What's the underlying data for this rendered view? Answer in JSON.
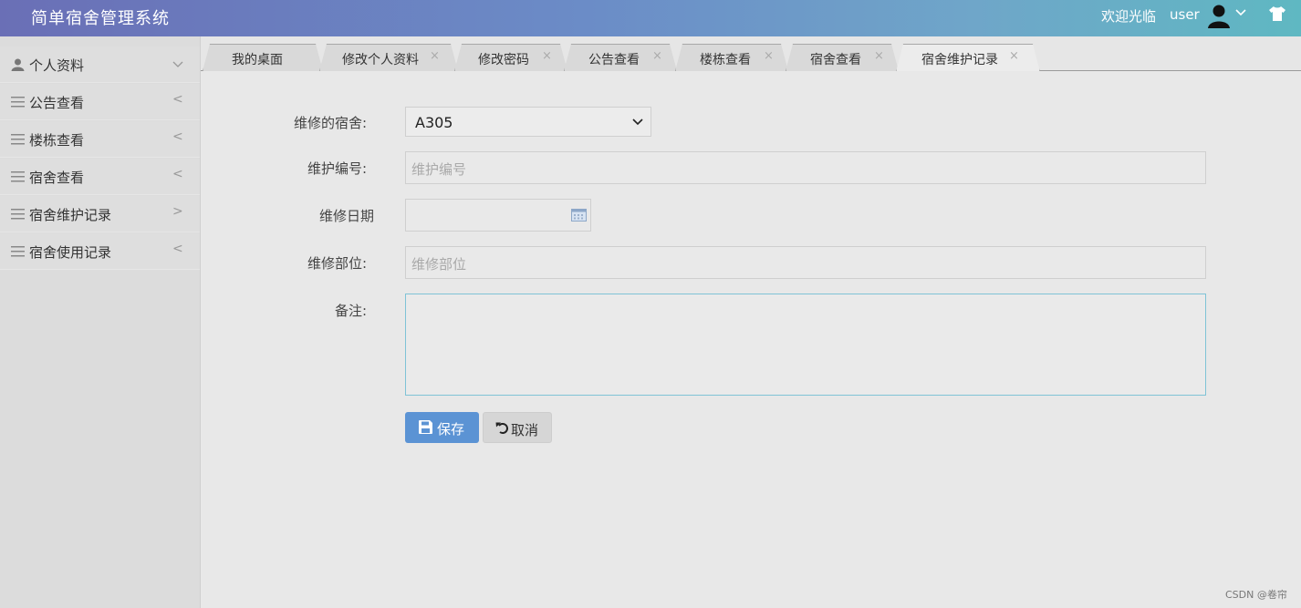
{
  "header": {
    "app_title": "简单宿舍管理系统",
    "welcome": "欢迎光临",
    "username": "user"
  },
  "sidebar": {
    "items": [
      {
        "label": "个人资料",
        "icon": "user-icon",
        "arrow": "chevron-down"
      },
      {
        "label": "公告查看",
        "icon": "menu-icon",
        "arrow": "<"
      },
      {
        "label": "楼栋查看",
        "icon": "menu-icon",
        "arrow": "<"
      },
      {
        "label": "宿舍查看",
        "icon": "menu-icon",
        "arrow": "<"
      },
      {
        "label": "宿舍维护记录",
        "icon": "menu-icon",
        "arrow": ">"
      },
      {
        "label": "宿舍使用记录",
        "icon": "menu-icon",
        "arrow": "<"
      }
    ]
  },
  "tabs": [
    {
      "label": "我的桌面",
      "closable": false
    },
    {
      "label": "修改个人资料",
      "closable": true
    },
    {
      "label": "修改密码",
      "closable": true
    },
    {
      "label": "公告查看",
      "closable": true
    },
    {
      "label": "楼栋查看",
      "closable": true
    },
    {
      "label": "宿舍查看",
      "closable": true
    },
    {
      "label": "宿舍维护记录",
      "closable": true,
      "active": true
    }
  ],
  "tab_close_glyph": "×",
  "form": {
    "dorm_label": "维修的宿舍:",
    "dorm_value": "A305",
    "code_label": "维护编号:",
    "code_placeholder": "维护编号",
    "date_label": "维修日期",
    "part_label": "维修部位:",
    "part_placeholder": "维修部位",
    "remark_label": "备注:"
  },
  "buttons": {
    "save": "保存",
    "cancel": "取消"
  },
  "watermark": "CSDN @卷帘",
  "colors": {
    "save_button": "#5b93d4",
    "textarea_border": "#7fc3d6"
  }
}
